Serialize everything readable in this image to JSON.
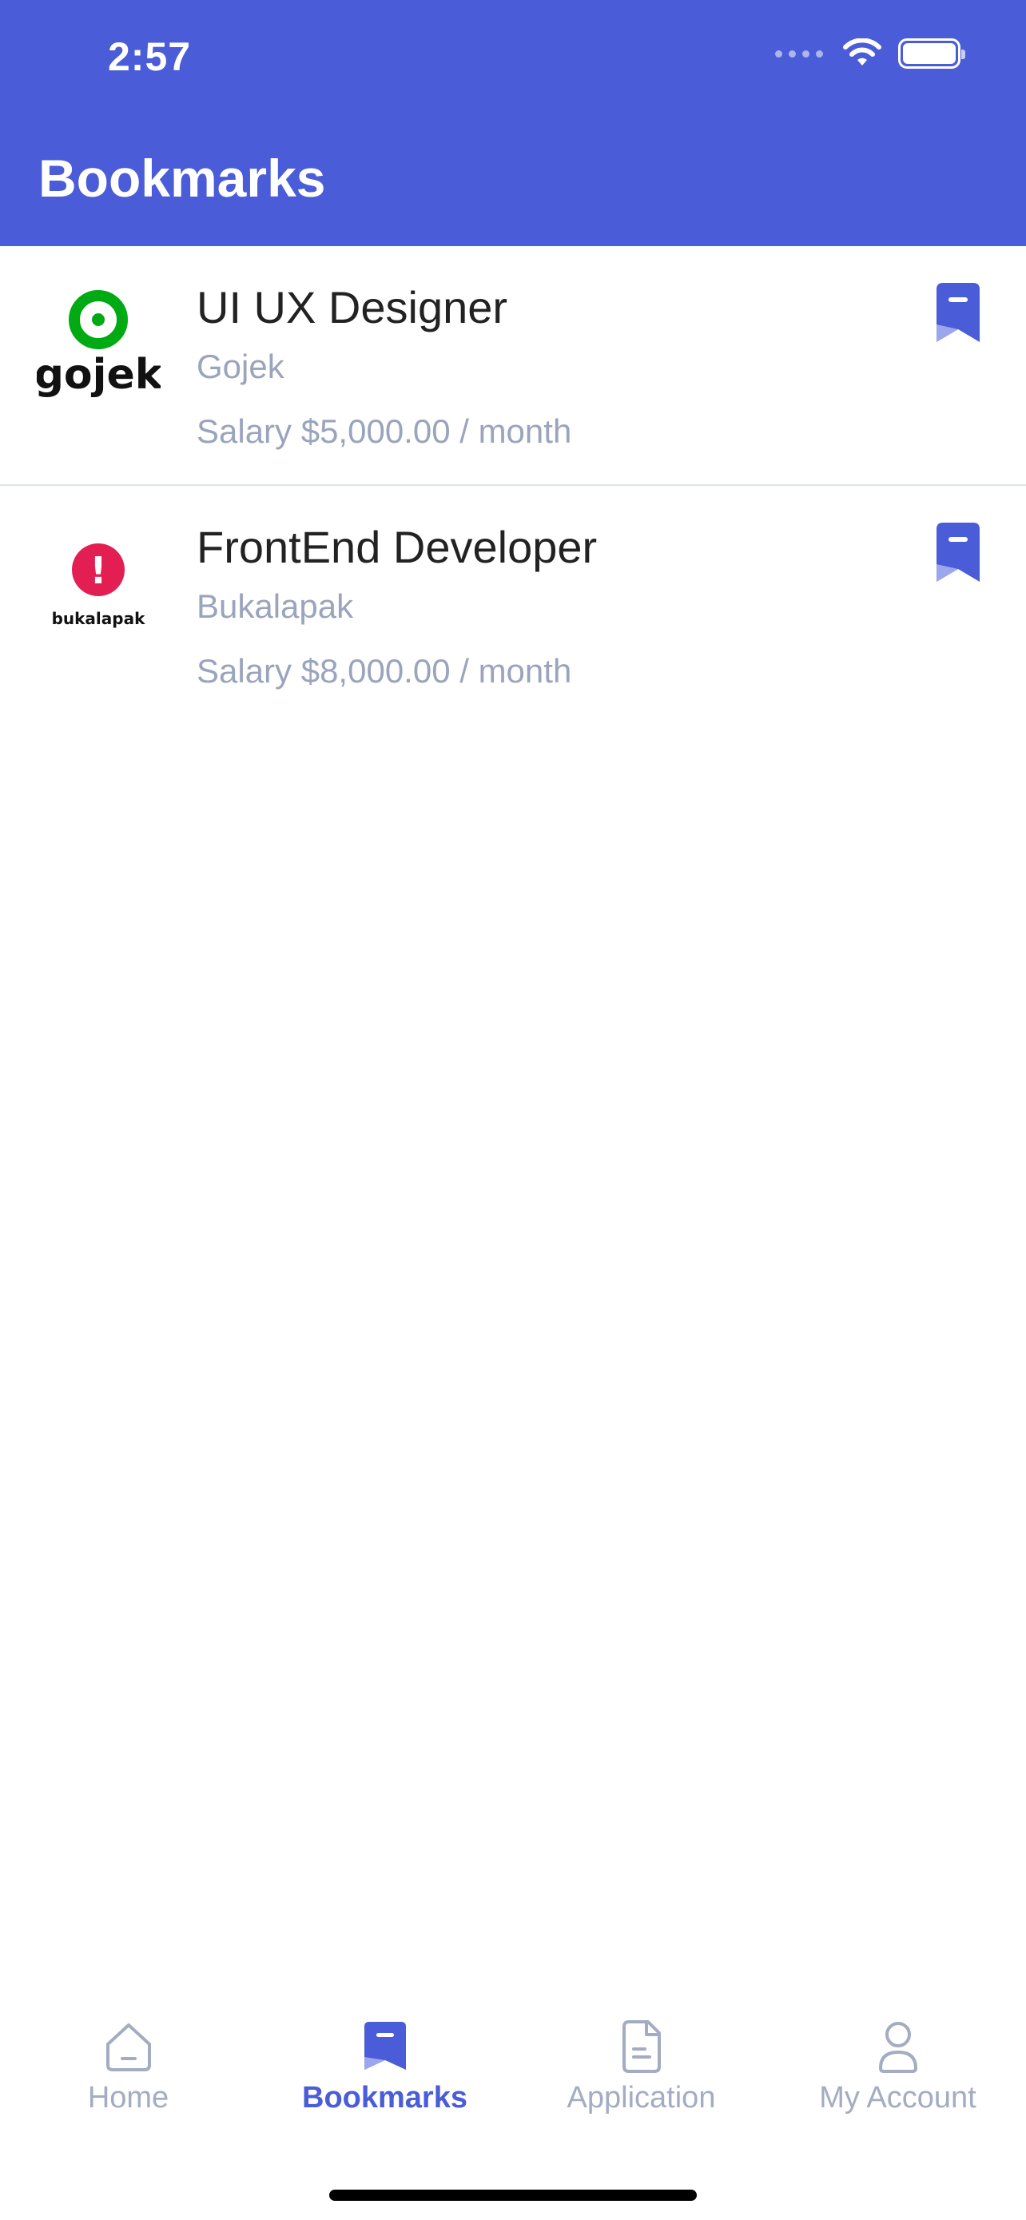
{
  "status_bar": {
    "time": "2:57"
  },
  "header": {
    "title": "Bookmarks"
  },
  "jobs": [
    {
      "title": "UI UX Designer",
      "company": "Gojek",
      "salary": "Salary $5,000.00 / month",
      "logo_text": "gojek"
    },
    {
      "title": "FrontEnd Developer",
      "company": "Bukalapak",
      "salary": "Salary $8,000.00 / month",
      "logo_text": "bukalapak"
    }
  ],
  "tabs": [
    {
      "label": "Home",
      "icon": "home-icon"
    },
    {
      "label": "Bookmarks",
      "icon": "bookmark-icon"
    },
    {
      "label": "Application",
      "icon": "document-icon"
    },
    {
      "label": "My Account",
      "icon": "user-icon"
    }
  ],
  "colors": {
    "primary": "#4A5CD8",
    "muted_text": "#9AA4BC",
    "gojek_green": "#00AA13",
    "bukalapak_red": "#E31E52"
  }
}
